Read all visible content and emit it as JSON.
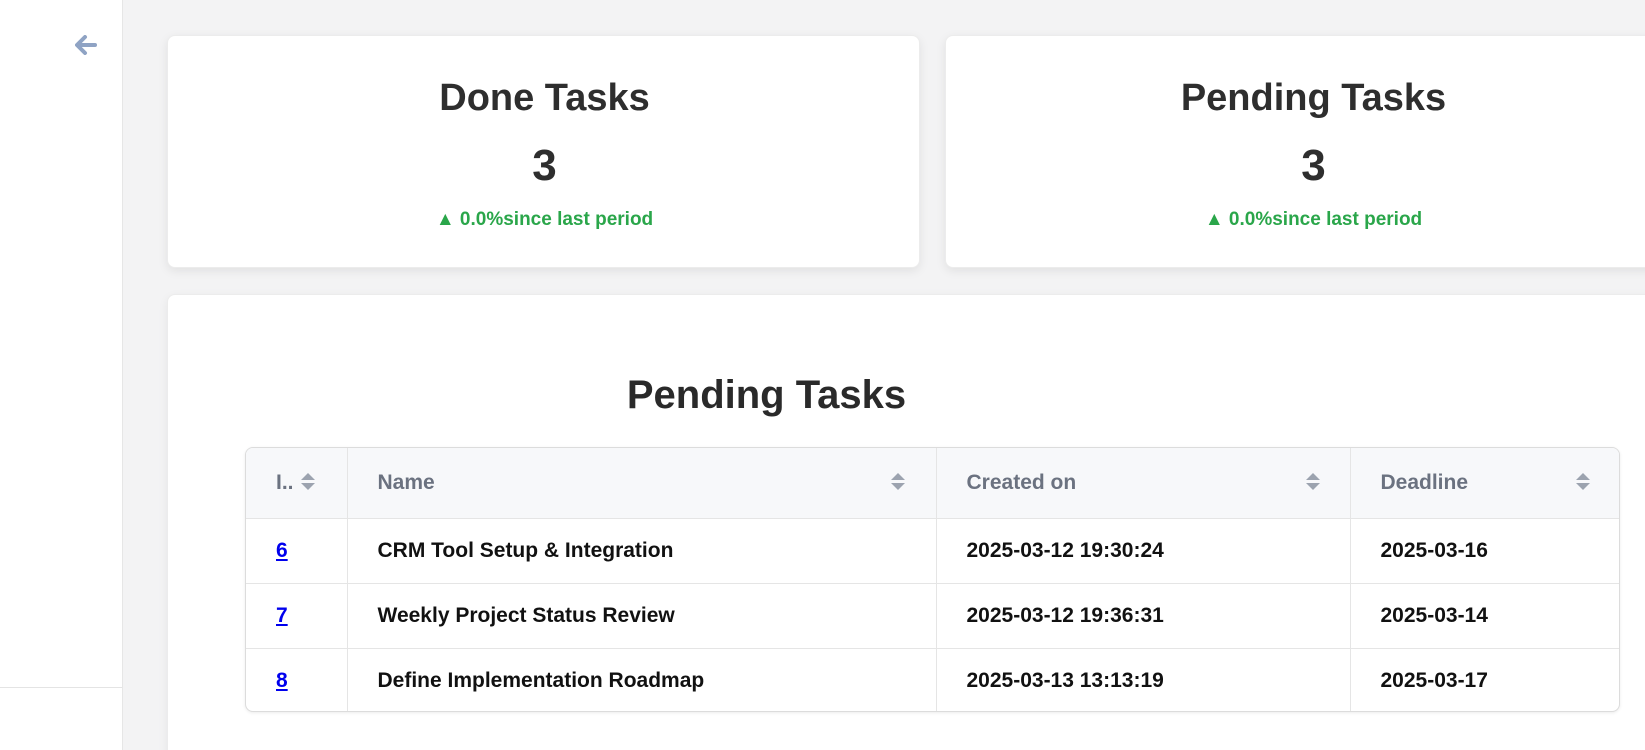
{
  "sidebar": {
    "back_icon": "arrow-left-icon"
  },
  "stats": {
    "done": {
      "title": "Done Tasks",
      "value": "3",
      "trend": "▲ 0.0%since last period"
    },
    "pending": {
      "title": "Pending Tasks",
      "value": "3",
      "trend": "▲ 0.0%since last period"
    }
  },
  "pending_table": {
    "title": "Pending Tasks",
    "columns": [
      "I..",
      "Name",
      "Created on",
      "Deadline"
    ],
    "rows": [
      {
        "id": "6",
        "name": "CRM Tool Setup & Integration",
        "created": "2025-03-12 19:30:24",
        "deadline": "2025-03-16"
      },
      {
        "id": "7",
        "name": "Weekly Project Status Review",
        "created": "2025-03-12 19:36:31",
        "deadline": "2025-03-14"
      },
      {
        "id": "8",
        "name": "Define Implementation Roadmap",
        "created": "2025-03-13 13:13:19",
        "deadline": "2025-03-17"
      }
    ]
  },
  "colors": {
    "trend_up": "#2aa64a",
    "link": "#0000ee",
    "back_icon": "#8fa3c4"
  }
}
